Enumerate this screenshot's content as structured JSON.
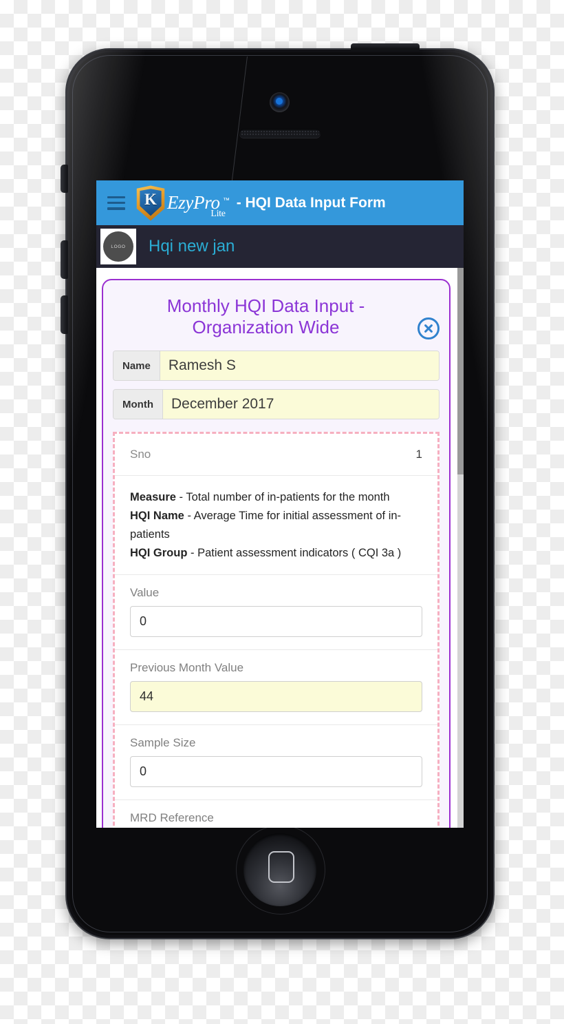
{
  "device": {
    "name": "black-smartphone",
    "buttons": {
      "power": "power-button",
      "silent": "silent-switch",
      "volume_up": "volume-up-button",
      "volume_down": "volume-down-button",
      "home": "home-button"
    }
  },
  "colors": {
    "header_blue": "#3498db",
    "sub_header_dark": "#252534",
    "org_name_cyan": "#2badd4",
    "card_border_purple": "#9b2fd0",
    "title_purple": "#8b35d6",
    "dashed_pink": "#f6afc0",
    "input_yellow": "#fbfbd8",
    "close_blue": "#3182ce"
  },
  "app_header": {
    "menu_icon": "hamburger-menu-icon",
    "brand": {
      "word": "EzyPro",
      "tm": "™",
      "lite": "Lite",
      "shield_letter": "K"
    },
    "title": "- HQI Data Input Form"
  },
  "sub_header": {
    "avatar_text": "LOGO",
    "org_name": "Hqi new jan"
  },
  "form": {
    "title": "Monthly HQI Data Input - Organization Wide",
    "close_icon": "close-circle-icon",
    "fields": [
      {
        "label": "Name",
        "value": "Ramesh S"
      },
      {
        "label": "Month",
        "value": "December 2017"
      }
    ]
  },
  "measure_section": {
    "sno_label": "Sno",
    "sno_value": "1",
    "details": [
      {
        "key": "Measure",
        "sep": " - ",
        "text": "Total number of in-patients for the month"
      },
      {
        "key": "HQI Name",
        "sep": " - ",
        "text": "Average Time for initial assessment of in-patients"
      },
      {
        "key": "HQI Group",
        "sep": " - ",
        "text": "Patient assessment indicators ( CQI 3a )"
      }
    ],
    "inputs": [
      {
        "label": "Value",
        "value": "0",
        "highlight": false
      },
      {
        "label": "Previous Month Value",
        "value": "44",
        "highlight": true
      },
      {
        "label": "Sample Size",
        "value": "0",
        "highlight": false
      },
      {
        "label": "MRD Reference",
        "value": "",
        "highlight": false
      }
    ]
  }
}
